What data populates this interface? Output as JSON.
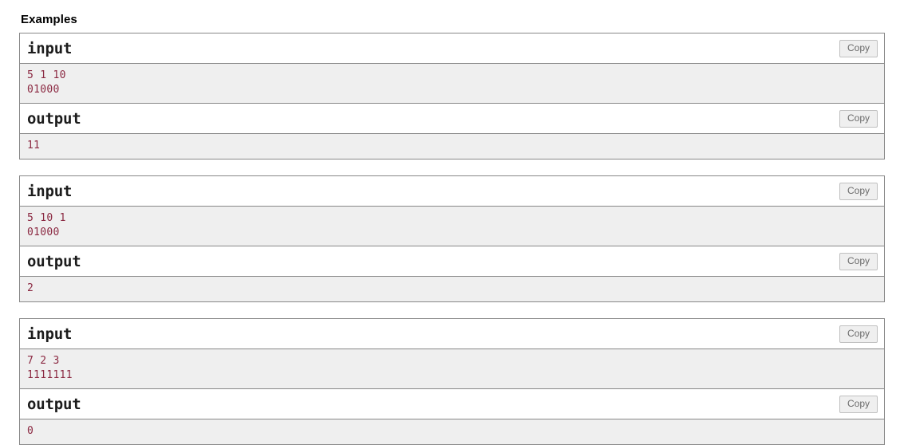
{
  "section": {
    "title": "Examples"
  },
  "labels": {
    "input": "input",
    "output": "output",
    "copy": "Copy"
  },
  "colors": {
    "text": "#8b2942",
    "body_background": "#efefef",
    "border": "#888888",
    "copy_button_text": "#6b6b6b",
    "copy_button_background": "#efefef",
    "header_text": "#1c1c1c"
  },
  "examples": [
    {
      "input": "5 1 10\n01000",
      "output": "11"
    },
    {
      "input": "5 10 1\n01000",
      "output": "2"
    },
    {
      "input": "7 2 3\n1111111",
      "output": "0"
    }
  ]
}
